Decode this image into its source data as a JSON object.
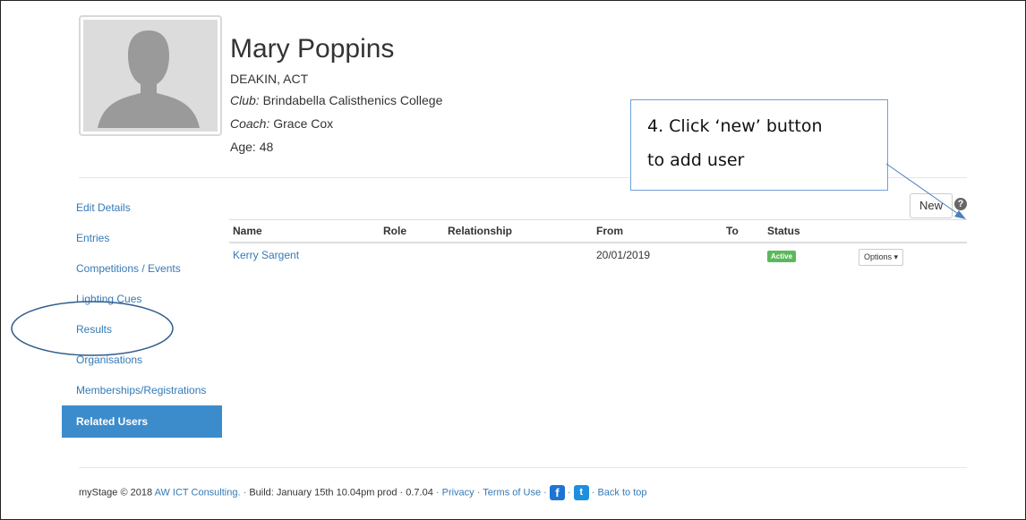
{
  "profile": {
    "name": "Mary Poppins",
    "location": "DEAKIN, ACT",
    "club_label": "Club:",
    "club": "Brindabella Calisthenics College",
    "coach_label": "Coach:",
    "coach": "Grace Cox",
    "age": "Age: 48"
  },
  "callout": {
    "line1": "4. Click ‘new’ button",
    "line2": "to add user"
  },
  "sidebar": {
    "items": [
      {
        "label": "Edit Details"
      },
      {
        "label": "Entries"
      },
      {
        "label": "Competitions / Events"
      },
      {
        "label": "Lighting Cues"
      },
      {
        "label": "Results"
      },
      {
        "label": "Organisations"
      },
      {
        "label": "Memberships/Registrations"
      },
      {
        "label": "Related Users",
        "active": true
      }
    ]
  },
  "toolbar": {
    "new_label": "New",
    "help_icon": "question-circle-icon"
  },
  "table": {
    "headers": [
      "Name",
      "Role",
      "Relationship",
      "From",
      "To",
      "Status"
    ],
    "rows": [
      {
        "name": "Kerry Sargent",
        "role": "",
        "relationship": "",
        "from": "20/01/2019",
        "to": "",
        "status": "Active",
        "options": "Options"
      }
    ]
  },
  "footer": {
    "brand": "myStage © 2018",
    "company": "AW ICT Consulting.",
    "build": "Build: January 15th 10.04pm prod · 0.7.04",
    "privacy": "Privacy",
    "terms": "Terms of Use",
    "back_to_top": "Back to top"
  },
  "colors": {
    "link": "#337ab7",
    "active_nav": "#3c8ccc",
    "badge": "#5cb85c",
    "annotation": "#2e5b8a"
  }
}
